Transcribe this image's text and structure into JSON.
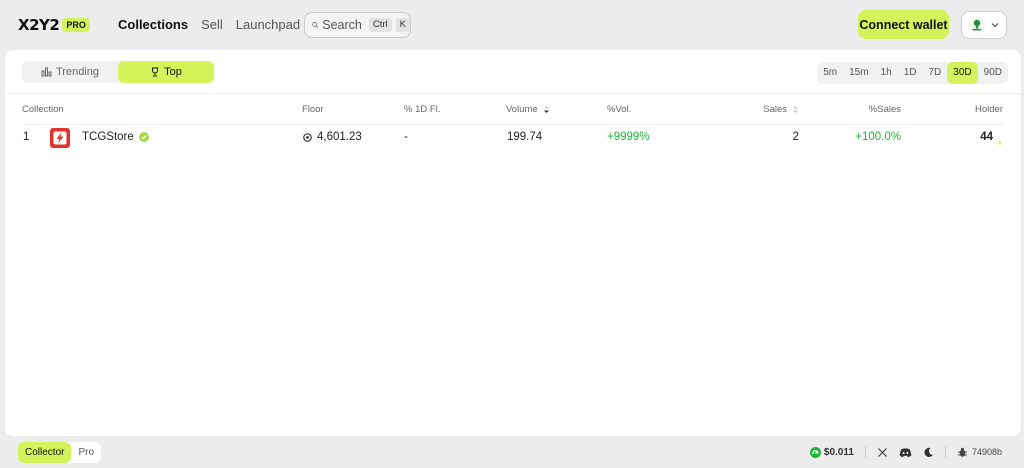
{
  "header": {
    "logo_text": "X2Y2",
    "logo_badge": "PRO",
    "nav": [
      {
        "label": "Collections",
        "active": true
      },
      {
        "label": "Sell",
        "active": false
      },
      {
        "label": "Launchpad",
        "active": false
      }
    ],
    "search": {
      "label": "Search",
      "kbd": [
        "Ctrl",
        "K"
      ]
    },
    "connect_label": "Connect wallet",
    "chain_icon": "chain-icon"
  },
  "tabs": {
    "items": [
      {
        "label": "Trending",
        "icon": "chart-icon",
        "active": false
      },
      {
        "label": "Top",
        "icon": "trophy-icon",
        "active": true
      }
    ]
  },
  "ranges": [
    {
      "label": "5m",
      "active": false
    },
    {
      "label": "15m",
      "active": false
    },
    {
      "label": "1h",
      "active": false
    },
    {
      "label": "1D",
      "active": false
    },
    {
      "label": "7D",
      "active": false
    },
    {
      "label": "30D",
      "active": true
    },
    {
      "label": "90D",
      "active": false
    }
  ],
  "table": {
    "columns": {
      "collection": "Collection",
      "floor": "Floor",
      "pct_floor": "% 1D Fl.",
      "volume": "Volume",
      "pct_vol": "%Vol.",
      "sales": "Sales",
      "pct_sales": "%Sales",
      "holder": "Holder"
    },
    "rows": [
      {
        "rank": "1",
        "name": "TCGStore",
        "verified": true,
        "floor": "4,601.23",
        "pct_floor": "-",
        "volume": "199.74",
        "pct_vol": "+9999%",
        "sales": "2",
        "pct_sales": "+100.0%",
        "holder": "44",
        "holder_level": 0.4
      }
    ]
  },
  "footer": {
    "modes": [
      {
        "label": "Collector",
        "active": true
      },
      {
        "label": "Pro",
        "active": false
      }
    ],
    "price": "$0.011",
    "build": "74908b"
  },
  "colors": {
    "accent": "#d4f25a",
    "positive": "#22b33a",
    "collection_logo": "#e2322d"
  }
}
